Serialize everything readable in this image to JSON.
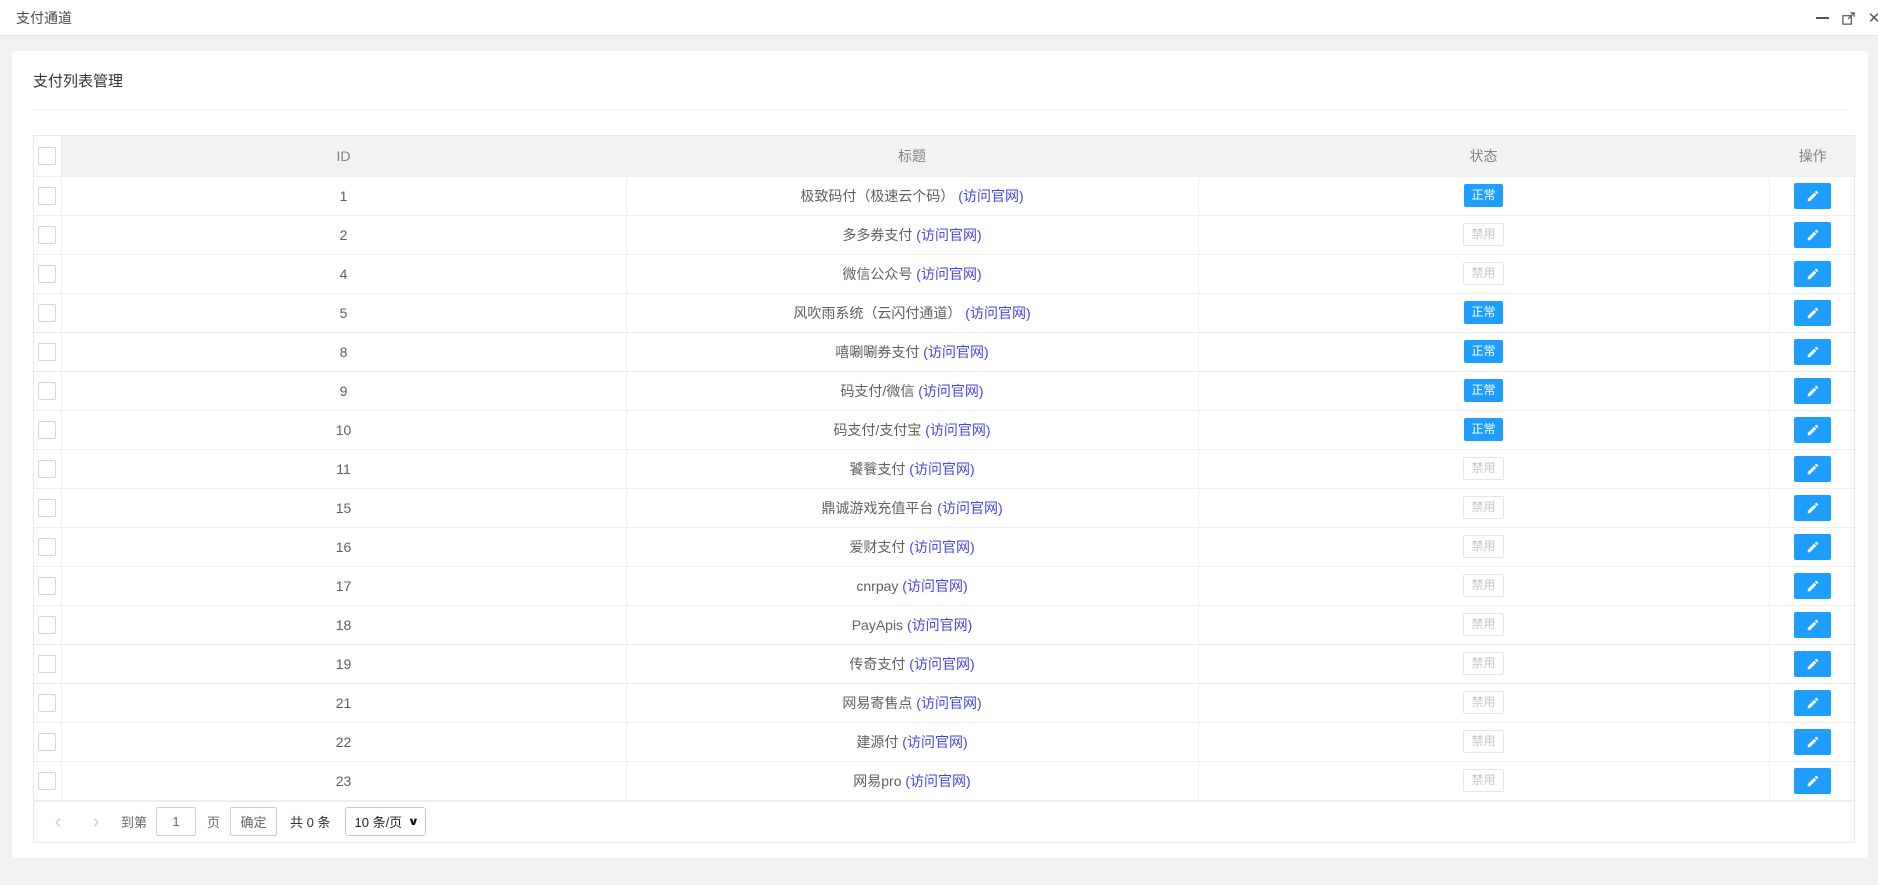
{
  "window": {
    "title": "支付通道"
  },
  "card": {
    "title": "支付列表管理"
  },
  "table": {
    "headers": {
      "id": "ID",
      "title": "标题",
      "status": "状态",
      "action": "操作"
    },
    "link_label": "(访问官网)",
    "rows": [
      {
        "id": "1",
        "title": "极致码付（极速云个码）",
        "status": "正常",
        "active": true
      },
      {
        "id": "2",
        "title": "多多券支付",
        "status": "禁用",
        "active": false
      },
      {
        "id": "4",
        "title": "微信公众号",
        "status": "禁用",
        "active": false
      },
      {
        "id": "5",
        "title": "风吹雨系统（云闪付通道）",
        "status": "正常",
        "active": true
      },
      {
        "id": "8",
        "title": "嘻唰唰券支付",
        "status": "正常",
        "active": true
      },
      {
        "id": "9",
        "title": "码支付/微信",
        "status": "正常",
        "active": true
      },
      {
        "id": "10",
        "title": "码支付/支付宝",
        "status": "正常",
        "active": true
      },
      {
        "id": "11",
        "title": "饕餮支付",
        "status": "禁用",
        "active": false
      },
      {
        "id": "15",
        "title": "鼎诚游戏充值平台",
        "status": "禁用",
        "active": false
      },
      {
        "id": "16",
        "title": "爱财支付",
        "status": "禁用",
        "active": false
      },
      {
        "id": "17",
        "title": "cnrpay",
        "status": "禁用",
        "active": false
      },
      {
        "id": "18",
        "title": "PayApis",
        "status": "禁用",
        "active": false
      },
      {
        "id": "19",
        "title": "传奇支付",
        "status": "禁用",
        "active": false
      },
      {
        "id": "21",
        "title": "网易寄售点",
        "status": "禁用",
        "active": false
      },
      {
        "id": "22",
        "title": "建源付",
        "status": "禁用",
        "active": false
      },
      {
        "id": "23",
        "title": "网易pro",
        "status": "禁用",
        "active": false
      }
    ]
  },
  "pagination": {
    "prev_glyph": "‹",
    "next_glyph": "›",
    "goto_label": "到第",
    "page_value": "1",
    "page_unit_label": "页",
    "confirm_label": "确定",
    "total_label": "共 0 条",
    "page_size_value": "10 条/页",
    "caret_glyph": "∨"
  },
  "colors": {
    "accent": "#1e9fff",
    "link": "#4545e5"
  }
}
